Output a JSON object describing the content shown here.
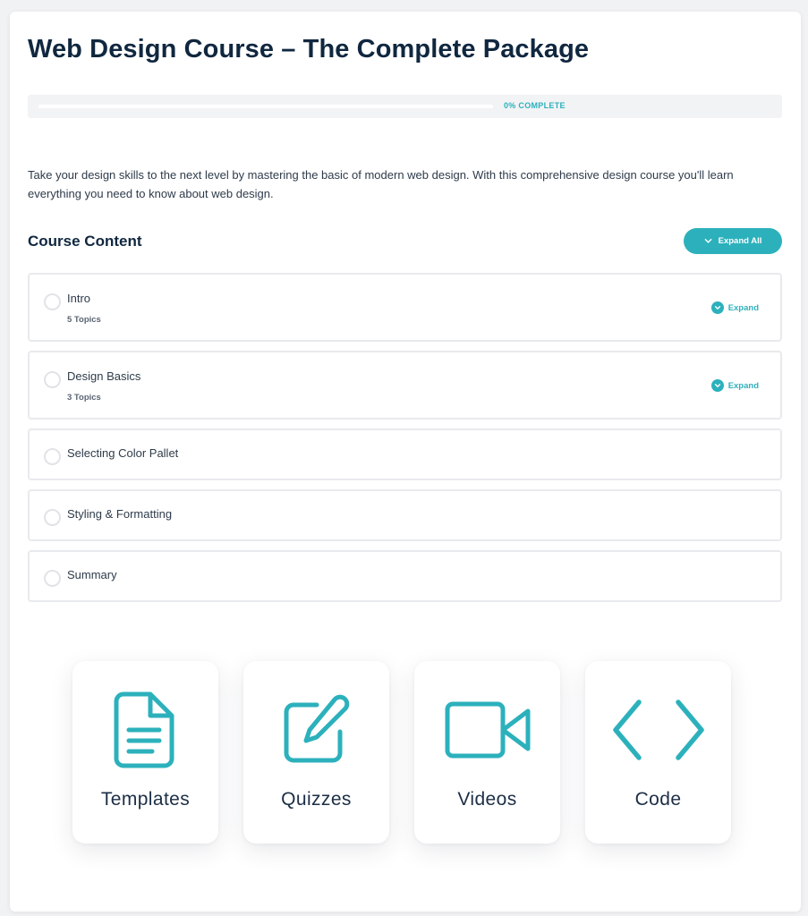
{
  "course": {
    "title": "Web Design Course – The Complete Package",
    "progress_text": "0% COMPLETE",
    "progress_fraction": 0,
    "description": "Take your design skills to the next level by mastering the basic of modern web design. With this comprehensive design course you'll learn everything you need to know about web design."
  },
  "content": {
    "heading": "Course Content",
    "expand_all_label": "Expand All",
    "expand_label": "Expand",
    "lessons": [
      {
        "name": "Intro",
        "topics": "5 Topics"
      },
      {
        "name": "Design Basics",
        "topics": "3 Topics"
      },
      {
        "name": "Selecting Color Pallet"
      },
      {
        "name": "Styling & Formatting"
      },
      {
        "name": "Summary"
      }
    ]
  },
  "features": [
    {
      "label": "Templates",
      "icon": "document-icon"
    },
    {
      "label": "Quizzes",
      "icon": "edit-icon"
    },
    {
      "label": "Videos",
      "icon": "video-camera-icon"
    },
    {
      "label": "Code",
      "icon": "code-icon"
    }
  ],
  "colors": {
    "accent": "#2cb1bc",
    "heading": "#10273f",
    "border": "#e8eaed"
  }
}
